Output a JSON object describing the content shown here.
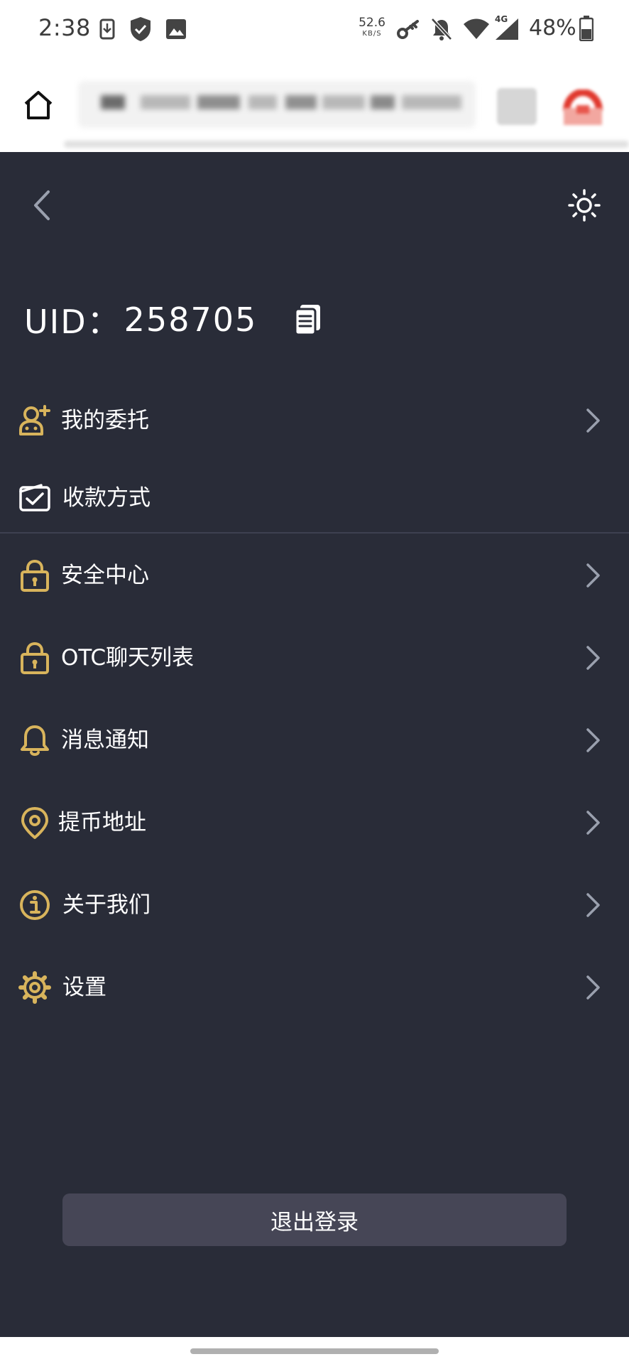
{
  "status_bar": {
    "time": "2:38",
    "net_speed_value": "52.6",
    "net_speed_unit": "KB/S",
    "network_type": "4G",
    "battery": "48%",
    "icons": [
      "download-notification-icon",
      "shield-icon",
      "image-icon",
      "key-icon",
      "bell-off-icon",
      "wifi-icon",
      "cell-signal-icon",
      "battery-icon"
    ]
  },
  "browser": {
    "icons": [
      "home-icon",
      "tabs-icon",
      "menu-avatar-icon"
    ]
  },
  "header": {
    "back_icon": "chevron-left-icon",
    "theme_icon": "sun-icon"
  },
  "account": {
    "uid_label": "UID：",
    "uid_value": "258705",
    "copy_icon": "copy-icon"
  },
  "menu": {
    "accent_color": "#d8b45c",
    "items": [
      {
        "label": "我的委托",
        "icon": "user-plus-icon",
        "chevron": true
      },
      {
        "label": "收款方式",
        "icon": "payment-check-icon",
        "chevron": false
      },
      {
        "label": "安全中心",
        "icon": "lock-icon",
        "chevron": true
      },
      {
        "label": "OTC聊天列表",
        "icon": "lock-icon",
        "chevron": true
      },
      {
        "label": "消息通知",
        "icon": "bell-icon",
        "chevron": true
      },
      {
        "label": "提币地址",
        "icon": "location-pin-icon",
        "chevron": true
      },
      {
        "label": "关于我们",
        "icon": "info-icon",
        "chevron": true
      },
      {
        "label": "设置",
        "icon": "gear-icon",
        "chevron": true
      }
    ]
  },
  "footer": {
    "logout_label": "退出登录"
  },
  "colors": {
    "background": "#292c38",
    "button": "#464656",
    "divider": "#3d4050",
    "accent": "#d8b45c"
  }
}
